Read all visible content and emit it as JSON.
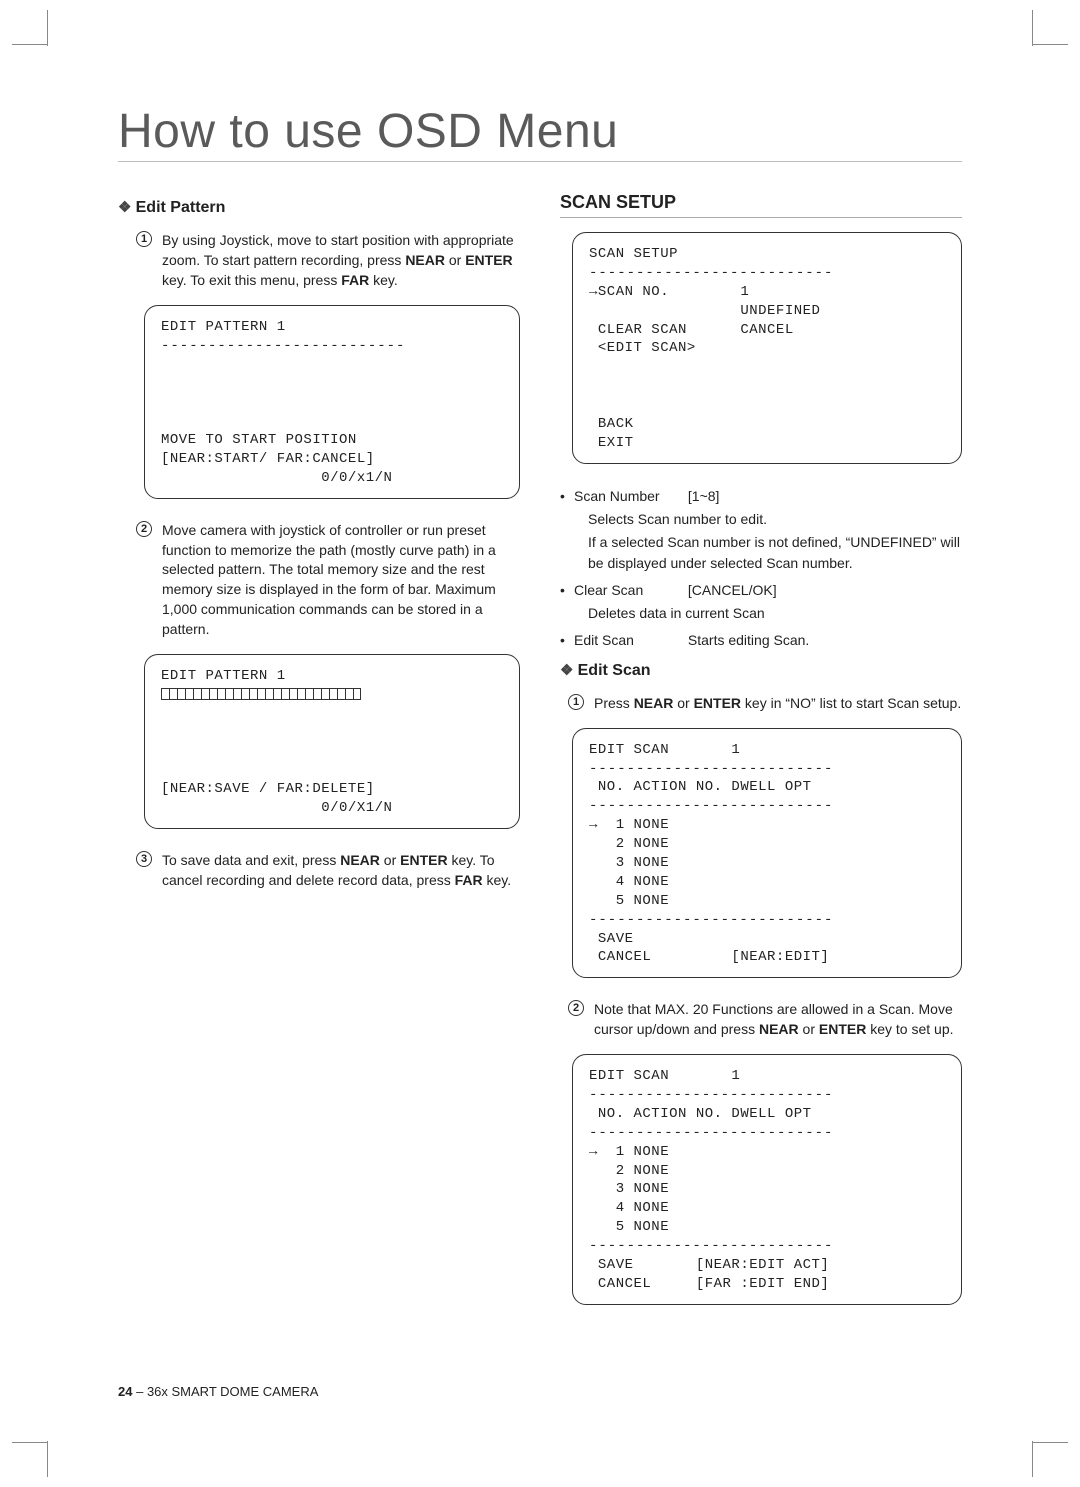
{
  "page": {
    "title": "How to use OSD Menu",
    "footer_page": "24",
    "footer_sep": " – ",
    "footer_product": "36x SMART DOME CAMERA"
  },
  "left": {
    "heading": "Edit Pattern",
    "step1_pre": "By using Joystick, move to start position with appropriate zoom. To start pattern recording, press ",
    "step1_b1": "NEAR",
    "step1_mid1": " or ",
    "step1_b2": "ENTER",
    "step1_mid2": " key. To exit this menu, press ",
    "step1_b3": "FAR",
    "step1_end": " key.",
    "osd1_title": "EDIT PATTERN 1",
    "osd1_dash": "--------------------------",
    "osd1_l1": "MOVE TO START POSITION",
    "osd1_l2": "[NEAR:START/ FAR:CANCEL]",
    "osd1_l3": "                  0/0/x1/N",
    "step2": "Move camera with joystick of controller or run preset function to memorize the path (mostly curve path) in a selected pattern. The total memory size and the rest memory size is displayed in the form of bar. Maximum 1,000 communication commands can be stored in a pattern.",
    "osd2_title": "EDIT PATTERN 1",
    "osd2_l1": "[NEAR:SAVE / FAR:DELETE]",
    "osd2_l2": "                  0/0/X1/N",
    "step3_pre": "To save data and exit, press ",
    "step3_b1": "NEAR",
    "step3_mid1": " or ",
    "step3_b2": "ENTER",
    "step3_mid2": " key. To cancel recording and delete record data, press ",
    "step3_b3": "FAR",
    "step3_end": " key."
  },
  "right": {
    "section": "SCAN SETUP",
    "osd1_title": "SCAN SETUP",
    "osd1_dash": "--------------------------",
    "osd1_r1": "→SCAN NO.        1",
    "osd1_r2": "                 UNDEFINED",
    "osd1_r3": " CLEAR SCAN      CANCEL",
    "osd1_r4": " <EDIT SCAN>",
    "osd1_r5": " BACK",
    "osd1_r6": " EXIT",
    "bul1_lbl": "Scan Number",
    "bul1_val": "[1~8]",
    "bul1_d1": "Selects Scan number to edit.",
    "bul1_d2": "If a selected   Scan number is not defined, “UNDEFINED” will be displayed under selected Scan number.",
    "bul2_lbl": "Clear Scan",
    "bul2_val": "[CANCEL/OK]",
    "bul2_d1": "Deletes data in current Scan",
    "bul3_lbl": "Edit Scan",
    "bul3_val": "Starts editing Scan.",
    "edit_heading": "Edit Scan",
    "es_step1_pre": "Press ",
    "es_step1_b1": "NEAR",
    "es_step1_mid": " or ",
    "es_step1_b2": "ENTER",
    "es_step1_end": " key in “NO” list to start Scan setup.",
    "osd2_title": "EDIT SCAN       1",
    "osd2_dash": "--------------------------",
    "osd2_hdr": " NO. ACTION NO. DWELL OPT",
    "osd2_r1": "→  1 NONE",
    "osd2_r2": "   2 NONE",
    "osd2_r3": "   3 NONE",
    "osd2_r4": "   4 NONE",
    "osd2_r5": "   5 NONE",
    "osd2_r6": " SAVE",
    "osd2_r7": " CANCEL         [NEAR:EDIT]",
    "es_step2_pre": "Note that MAX. 20 Functions are allowed in a Scan. Move cursor up/down and press ",
    "es_step2_b1": "NEAR",
    "es_step2_mid": " or ",
    "es_step2_b2": "ENTER",
    "es_step2_end": " key to set up.",
    "osd3_title": "EDIT SCAN       1",
    "osd3_dash": "--------------------------",
    "osd3_hdr": " NO. ACTION NO. DWELL OPT",
    "osd3_r1": "→  1 NONE",
    "osd3_r2": "   2 NONE",
    "osd3_r3": "   3 NONE",
    "osd3_r4": "   4 NONE",
    "osd3_r5": "   5 NONE",
    "osd3_r6": " SAVE       [NEAR:EDIT ACT]",
    "osd3_r7": " CANCEL     [FAR :EDIT END]"
  }
}
